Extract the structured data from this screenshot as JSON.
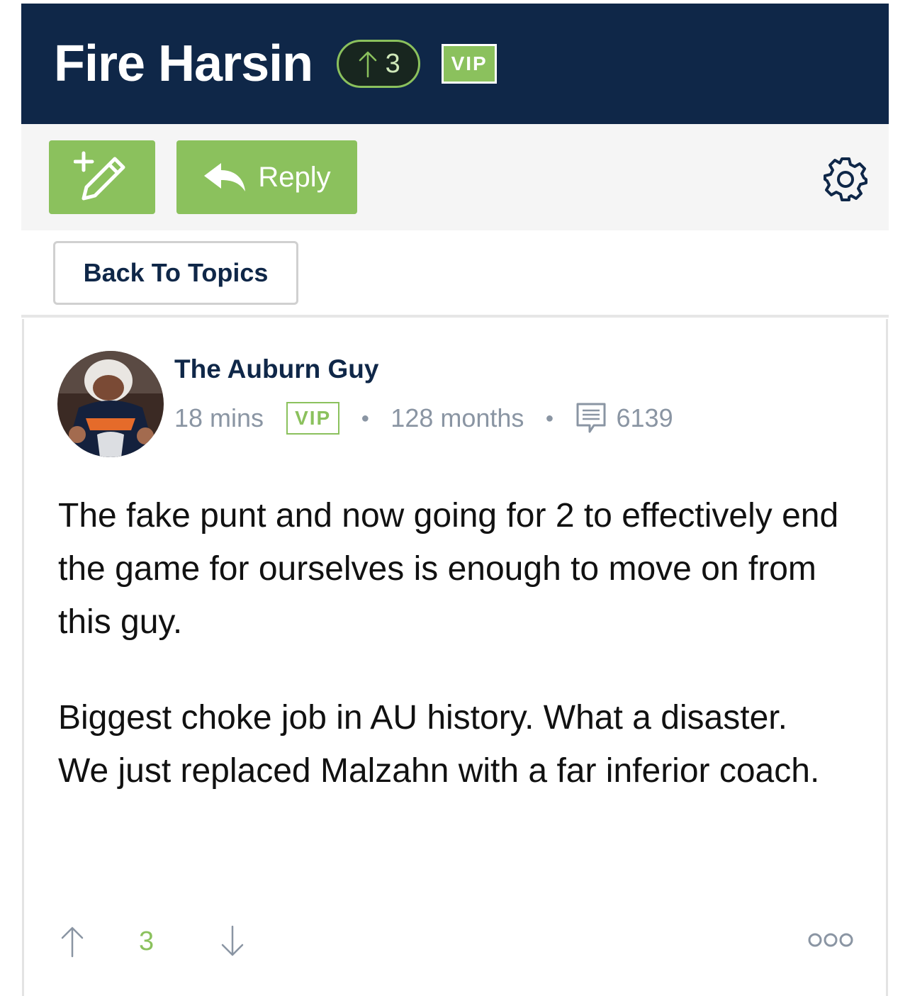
{
  "topic": {
    "title": "Fire Harsin",
    "vote_count": "3",
    "vip_label": "VIP"
  },
  "toolbar": {
    "new_post_icon": "pencil-plus-icon",
    "reply_label": "Reply",
    "reply_icon": "reply-arrow-icon",
    "settings_icon": "gear-icon"
  },
  "navigation": {
    "back_label": "Back To Topics"
  },
  "post": {
    "author": "The Auburn Guy",
    "time": "18 mins",
    "vip_label": "VIP",
    "membership": "128 months",
    "post_count": "6139",
    "body": [
      "The fake punt and now going for 2 to effectively end the game for ourselves is enough to move on from this guy.",
      "Biggest choke job in AU history. What a disaster. We just replaced Malzahn with a far inferior coach."
    ],
    "vote_count": "3"
  },
  "colors": {
    "navy": "#0f2748",
    "accent_green": "#8bc15d",
    "meta_gray": "#8a95a3"
  }
}
